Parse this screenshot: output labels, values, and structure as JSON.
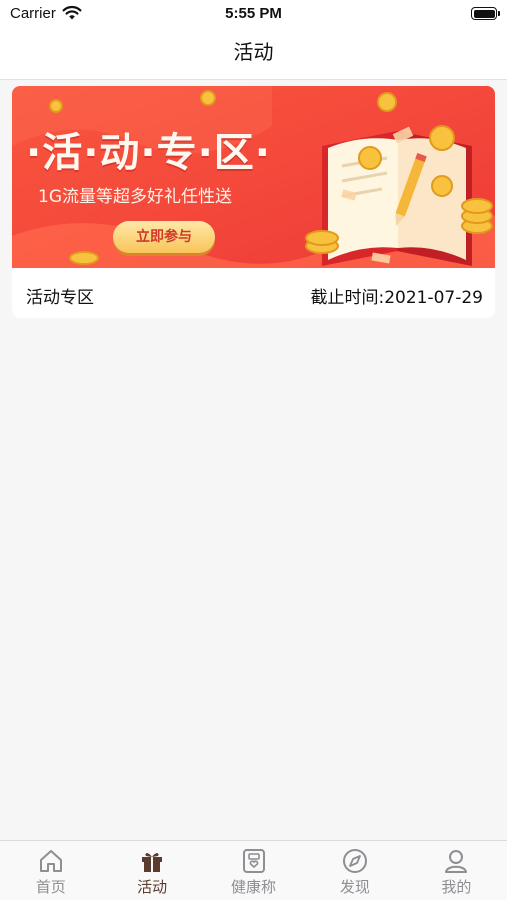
{
  "status_bar": {
    "carrier": "Carrier",
    "time": "5:55 PM"
  },
  "nav": {
    "title": "活动"
  },
  "activity": {
    "banner_title": "·活·动·专·区·",
    "banner_subtitle": "1G流量等超多好礼任性送",
    "join_label": "立即参与",
    "name": "活动专区",
    "deadline": "截止时间:2021-07-29"
  },
  "tabs": [
    {
      "label": "首页",
      "icon": "home-icon",
      "active": false
    },
    {
      "label": "活动",
      "icon": "gift-icon",
      "active": true
    },
    {
      "label": "健康称",
      "icon": "scale-icon",
      "active": false
    },
    {
      "label": "发现",
      "icon": "compass-icon",
      "active": false
    },
    {
      "label": "我的",
      "icon": "user-icon",
      "active": false
    }
  ],
  "colors": {
    "banner_red": "#f0463a",
    "active_tab": "#5a3b2e",
    "inactive_tab": "#8e8e93"
  }
}
